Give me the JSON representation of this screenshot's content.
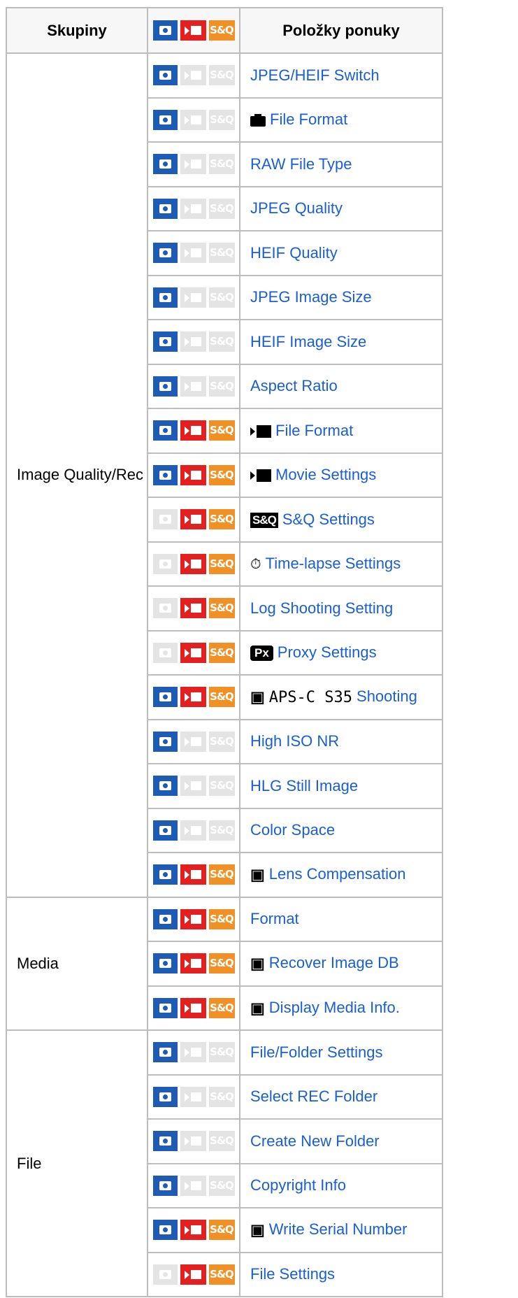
{
  "header": {
    "col1": "Skupiny",
    "col3": "Položky ponuky"
  },
  "groups": [
    {
      "name": "Image Quality/Rec"
    },
    {
      "name": "Media"
    },
    {
      "name": "File"
    }
  ],
  "rows": [
    {
      "group": 0,
      "cam": true,
      "mov": false,
      "snq": false,
      "prefix": "",
      "label": "JPEG/HEIF Switch"
    },
    {
      "group": 0,
      "cam": true,
      "mov": false,
      "snq": false,
      "prefix": "camera-icon",
      "label": "File Format"
    },
    {
      "group": 0,
      "cam": true,
      "mov": false,
      "snq": false,
      "prefix": "",
      "label": "RAW File Type"
    },
    {
      "group": 0,
      "cam": true,
      "mov": false,
      "snq": false,
      "prefix": "",
      "label": "JPEG Quality"
    },
    {
      "group": 0,
      "cam": true,
      "mov": false,
      "snq": false,
      "prefix": "",
      "label": "HEIF Quality"
    },
    {
      "group": 0,
      "cam": true,
      "mov": false,
      "snq": false,
      "prefix": "",
      "label": "JPEG Image Size"
    },
    {
      "group": 0,
      "cam": true,
      "mov": false,
      "snq": false,
      "prefix": "",
      "label": "HEIF Image Size"
    },
    {
      "group": 0,
      "cam": true,
      "mov": false,
      "snq": false,
      "prefix": "",
      "label": "Aspect Ratio"
    },
    {
      "group": 0,
      "cam": true,
      "mov": true,
      "snq": true,
      "prefix": "movie-icon",
      "label": "File Format"
    },
    {
      "group": 0,
      "cam": true,
      "mov": true,
      "snq": true,
      "prefix": "movie-icon",
      "label": "Movie Settings"
    },
    {
      "group": 0,
      "cam": false,
      "mov": true,
      "snq": true,
      "prefix": "sq-icon",
      "label": "S&Q Settings"
    },
    {
      "group": 0,
      "cam": false,
      "mov": true,
      "snq": true,
      "prefix": "timelapse-icon",
      "label": "Time-lapse Settings"
    },
    {
      "group": 0,
      "cam": false,
      "mov": true,
      "snq": true,
      "prefix": "",
      "label": "Log Shooting Setting"
    },
    {
      "group": 0,
      "cam": false,
      "mov": true,
      "snq": true,
      "prefix": "proxy-icon",
      "label": "Proxy Settings"
    },
    {
      "group": 0,
      "cam": true,
      "mov": true,
      "snq": true,
      "prefix": "camera-movie-apsc-icon",
      "label": "Shooting"
    },
    {
      "group": 0,
      "cam": true,
      "mov": false,
      "snq": false,
      "prefix": "",
      "label": "High ISO NR"
    },
    {
      "group": 0,
      "cam": true,
      "mov": false,
      "snq": false,
      "prefix": "",
      "label": "HLG Still Image"
    },
    {
      "group": 0,
      "cam": true,
      "mov": false,
      "snq": false,
      "prefix": "",
      "label": "Color Space"
    },
    {
      "group": 0,
      "cam": true,
      "mov": true,
      "snq": true,
      "prefix": "camera-movie-icon",
      "label": "Lens Compensation"
    },
    {
      "group": 1,
      "cam": true,
      "mov": true,
      "snq": true,
      "prefix": "",
      "label": "Format"
    },
    {
      "group": 1,
      "cam": true,
      "mov": true,
      "snq": true,
      "prefix": "camera-movie-icon",
      "label": "Recover Image DB"
    },
    {
      "group": 1,
      "cam": true,
      "mov": true,
      "snq": true,
      "prefix": "camera-movie-icon",
      "label": "Display Media Info."
    },
    {
      "group": 2,
      "cam": true,
      "mov": false,
      "snq": false,
      "prefix": "",
      "label": "File/Folder Settings"
    },
    {
      "group": 2,
      "cam": true,
      "mov": false,
      "snq": false,
      "prefix": "",
      "label": "Select REC Folder"
    },
    {
      "group": 2,
      "cam": true,
      "mov": false,
      "snq": false,
      "prefix": "",
      "label": "Create New Folder"
    },
    {
      "group": 2,
      "cam": true,
      "mov": false,
      "snq": false,
      "prefix": "",
      "label": "Copyright Info"
    },
    {
      "group": 2,
      "cam": true,
      "mov": true,
      "snq": true,
      "prefix": "camera-movie-icon",
      "label": "Write Serial Number"
    },
    {
      "group": 2,
      "cam": false,
      "mov": true,
      "snq": true,
      "prefix": "",
      "label": "File Settings"
    }
  ],
  "badges": {
    "snq_text": "S&Q",
    "sq_prefix_text": "S&Q",
    "proxy_text": "Px",
    "apsc_text": "APS-C S35",
    "timelapse_glyph": "⏱"
  },
  "colors": {
    "camera": "#1d5bb5",
    "movie": "#e41f1f",
    "snq": "#f19024",
    "disabled": "#e4e4e4",
    "link": "#1a5fd0",
    "border": "#bdbdbd"
  }
}
